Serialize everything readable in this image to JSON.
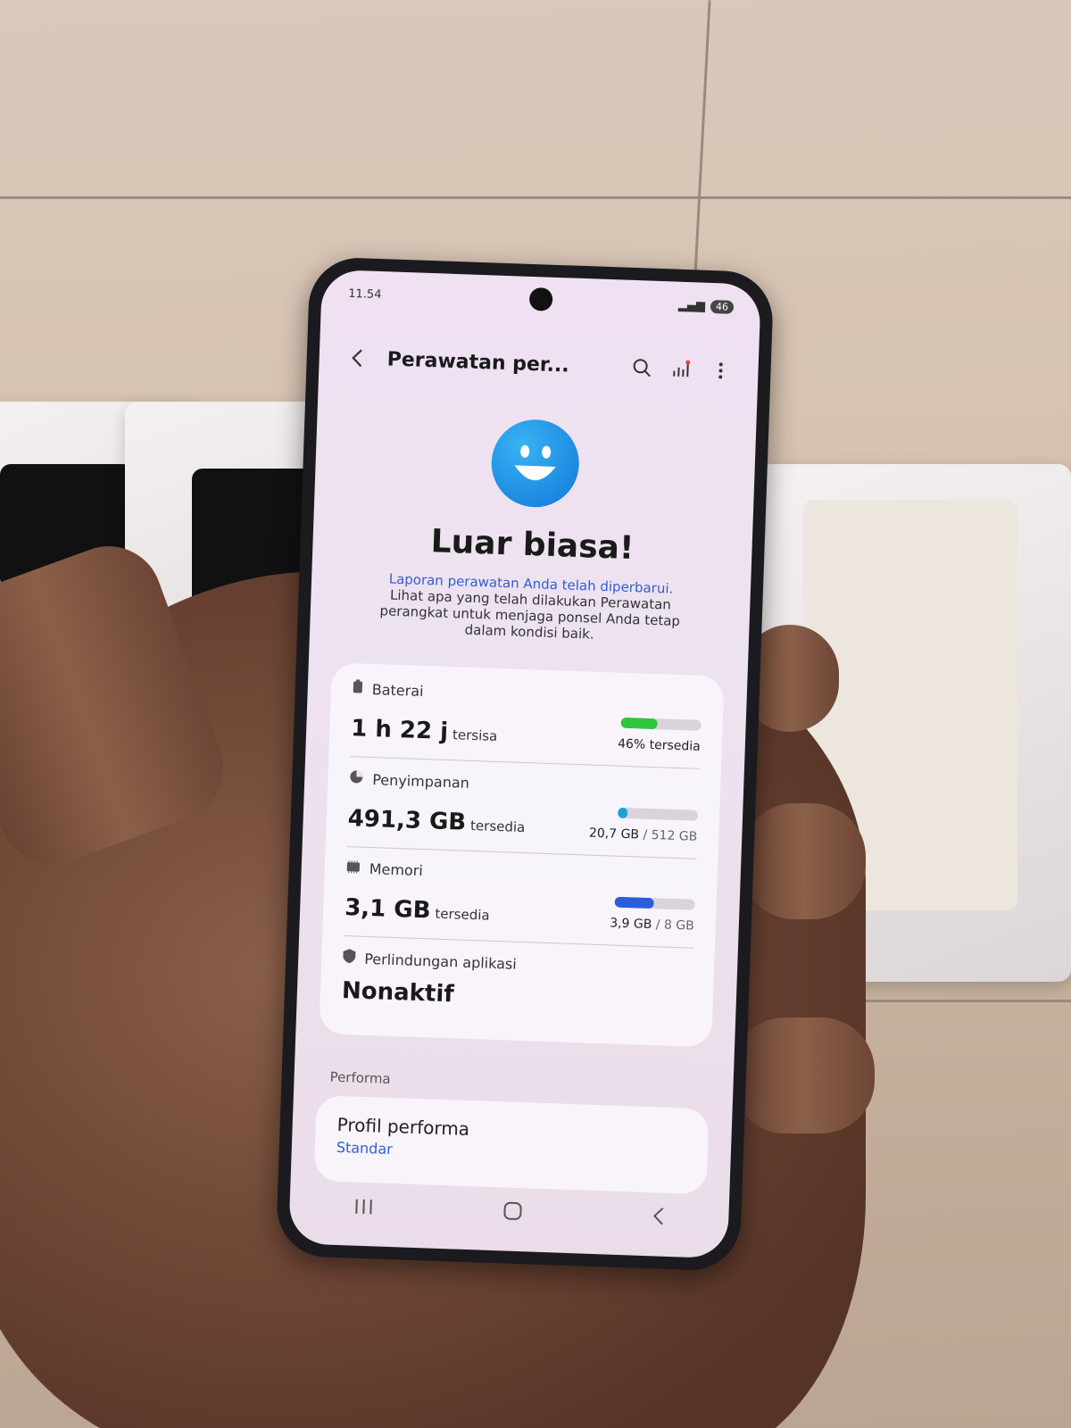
{
  "status_bar": {
    "time": "11.54",
    "battery": "46"
  },
  "toolbar": {
    "title": "Perawatan per..."
  },
  "hero": {
    "headline": "Luar biasa!",
    "desc_link": "Laporan perawatan Anda telah diperbarui.",
    "desc_text": " Lihat apa yang telah dilakukan Perawatan perangkat untuk menjaga ponsel Anda tetap dalam kondisi baik."
  },
  "items": [
    {
      "label": "Baterai",
      "value": "1 h 22 j",
      "suffix": "tersisa",
      "right": "46% tersedia",
      "right_muted": "",
      "level": 0.46,
      "color": "#2fc53c"
    },
    {
      "label": "Penyimpanan",
      "value": "491,3 GB",
      "suffix": "tersedia",
      "right": "20,7 GB",
      "right_muted": " / 512 GB",
      "level": 0.04,
      "color": "#1ba3d6"
    },
    {
      "label": "Memori",
      "value": "3,1 GB",
      "suffix": "tersedia",
      "right": "3,9 GB",
      "right_muted": " / 8 GB",
      "level": 0.49,
      "color": "#2a5fdc"
    },
    {
      "label": "Perlindungan aplikasi",
      "value": "Nonaktif",
      "suffix": "",
      "right": "",
      "right_muted": ""
    }
  ],
  "performance": {
    "section": "Performa",
    "title": "Profil performa",
    "value": "Standar"
  },
  "icons": [
    "back-icon",
    "search-icon",
    "stats-icon",
    "more-icon",
    "battery-icon",
    "storage-icon",
    "memory-icon",
    "shield-icon",
    "recents-icon",
    "home-icon",
    "nav-back-icon"
  ]
}
